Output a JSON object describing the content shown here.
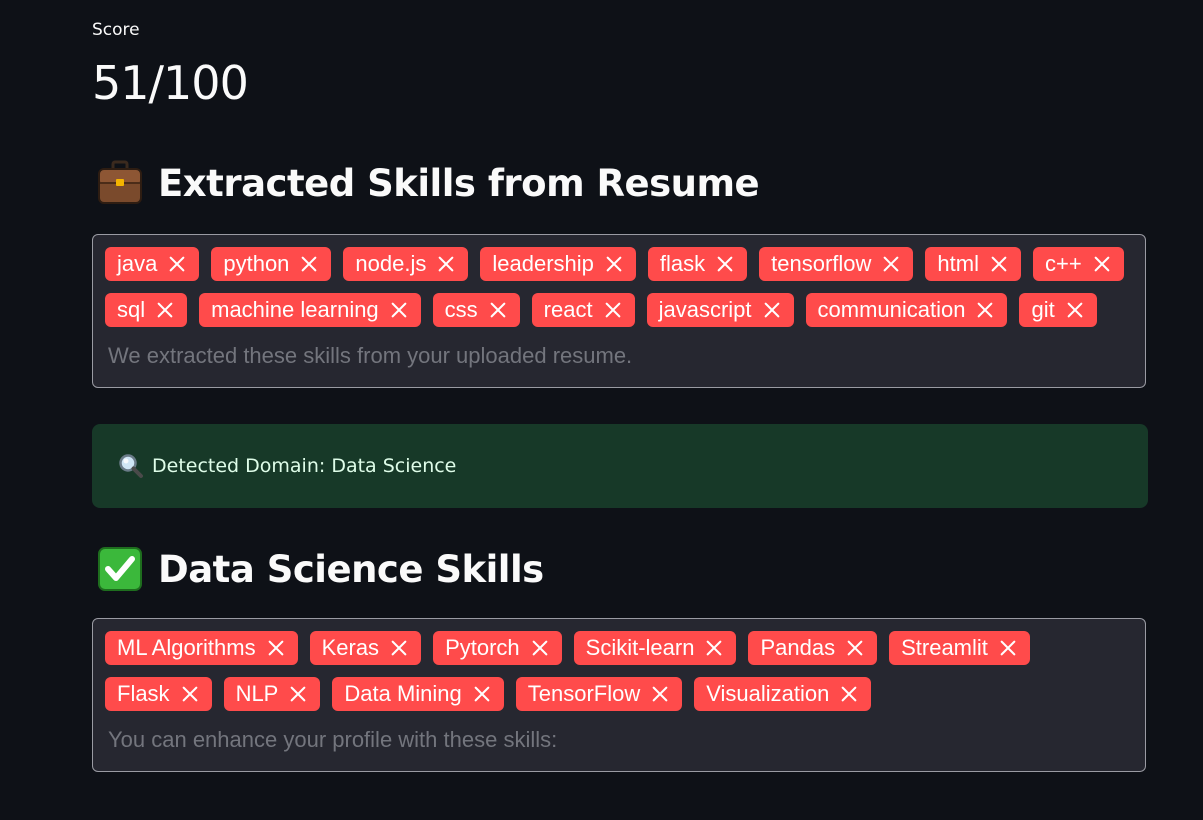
{
  "metric": {
    "label": "Score",
    "value": "51/100"
  },
  "extracted": {
    "icon": "briefcase-icon",
    "title": "Extracted Skills from Resume",
    "tags": [
      "java",
      "python",
      "node.js",
      "leadership",
      "flask",
      "tensorflow",
      "html",
      "c++",
      "sql",
      "machine learning",
      "css",
      "react",
      "javascript",
      "communication",
      "git"
    ],
    "placeholder": "We extracted these skills from your uploaded resume."
  },
  "domain": {
    "icon": "magnifying-glass-icon",
    "text": "Detected Domain: Data Science",
    "color": "#173928"
  },
  "recommended": {
    "icon": "check-mark-icon",
    "title": "Data Science Skills",
    "tags": [
      "ML Algorithms",
      "Keras",
      "Pytorch",
      "Scikit-learn",
      "Pandas",
      "Streamlit",
      "Flask",
      "NLP",
      "Data Mining",
      "TensorFlow",
      "Visualization"
    ],
    "placeholder": "You can enhance your profile with these skills:"
  },
  "colors": {
    "background": "#0e1117",
    "tag": "#ff4b4b",
    "input_bg": "#262730"
  }
}
